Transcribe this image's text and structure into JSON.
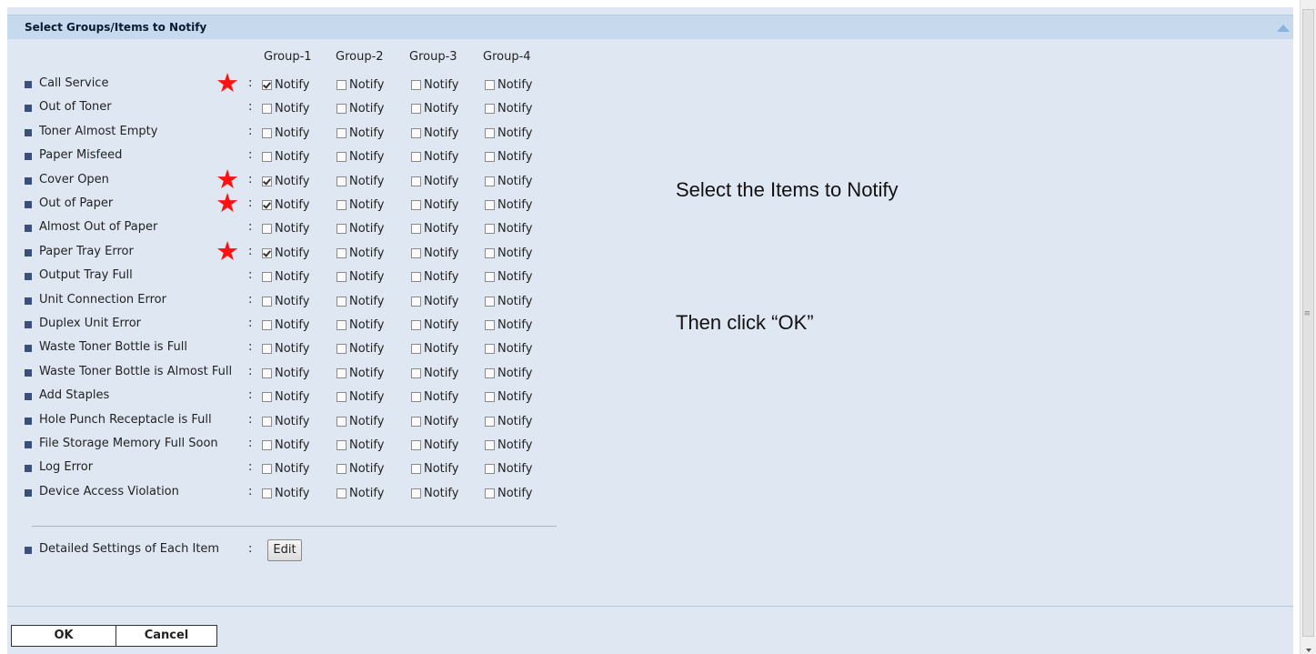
{
  "panel": {
    "title": "Select Groups/Items to Notify",
    "groups": [
      "Group-1",
      "Group-2",
      "Group-3",
      "Group-4"
    ],
    "checkbox_label": "Notify",
    "rows": [
      {
        "label": "Call Service",
        "starred": true,
        "checked": [
          true,
          false,
          false,
          false
        ]
      },
      {
        "label": "Out of Toner",
        "starred": false,
        "checked": [
          false,
          false,
          false,
          false
        ]
      },
      {
        "label": "Toner Almost Empty",
        "starred": false,
        "checked": [
          false,
          false,
          false,
          false
        ]
      },
      {
        "label": "Paper Misfeed",
        "starred": false,
        "checked": [
          false,
          false,
          false,
          false
        ]
      },
      {
        "label": "Cover Open",
        "starred": true,
        "checked": [
          true,
          false,
          false,
          false
        ]
      },
      {
        "label": "Out of Paper",
        "starred": true,
        "checked": [
          true,
          false,
          false,
          false
        ]
      },
      {
        "label": "Almost Out of Paper",
        "starred": false,
        "checked": [
          false,
          false,
          false,
          false
        ]
      },
      {
        "label": "Paper Tray Error",
        "starred": true,
        "checked": [
          true,
          false,
          false,
          false
        ]
      },
      {
        "label": "Output Tray Full",
        "starred": false,
        "checked": [
          false,
          false,
          false,
          false
        ]
      },
      {
        "label": "Unit Connection Error",
        "starred": false,
        "checked": [
          false,
          false,
          false,
          false
        ]
      },
      {
        "label": "Duplex Unit Error",
        "starred": false,
        "checked": [
          false,
          false,
          false,
          false
        ]
      },
      {
        "label": "Waste Toner Bottle is Full",
        "starred": false,
        "checked": [
          false,
          false,
          false,
          false
        ]
      },
      {
        "label": "Waste Toner Bottle is Almost Full",
        "starred": false,
        "checked": [
          false,
          false,
          false,
          false
        ]
      },
      {
        "label": "Add Staples",
        "starred": false,
        "checked": [
          false,
          false,
          false,
          false
        ]
      },
      {
        "label": "Hole Punch Receptacle is Full",
        "starred": false,
        "checked": [
          false,
          false,
          false,
          false
        ]
      },
      {
        "label": "File Storage Memory Full Soon",
        "starred": false,
        "checked": [
          false,
          false,
          false,
          false
        ]
      },
      {
        "label": "Log Error",
        "starred": false,
        "checked": [
          false,
          false,
          false,
          false
        ]
      },
      {
        "label": "Device Access Violation",
        "starred": false,
        "checked": [
          false,
          false,
          false,
          false
        ]
      }
    ],
    "detailed_label": "Detailed Settings of Each Item",
    "edit_label": "Edit"
  },
  "footer": {
    "ok_label": "OK",
    "cancel_label": "Cancel"
  },
  "callouts": {
    "select_text": "Select the Items to Notify",
    "click_text": "Then click “OK”"
  },
  "colors": {
    "star": "#ff1111",
    "header_bg": "#c7d9ec",
    "panel_bg": "#dfe8f2"
  }
}
